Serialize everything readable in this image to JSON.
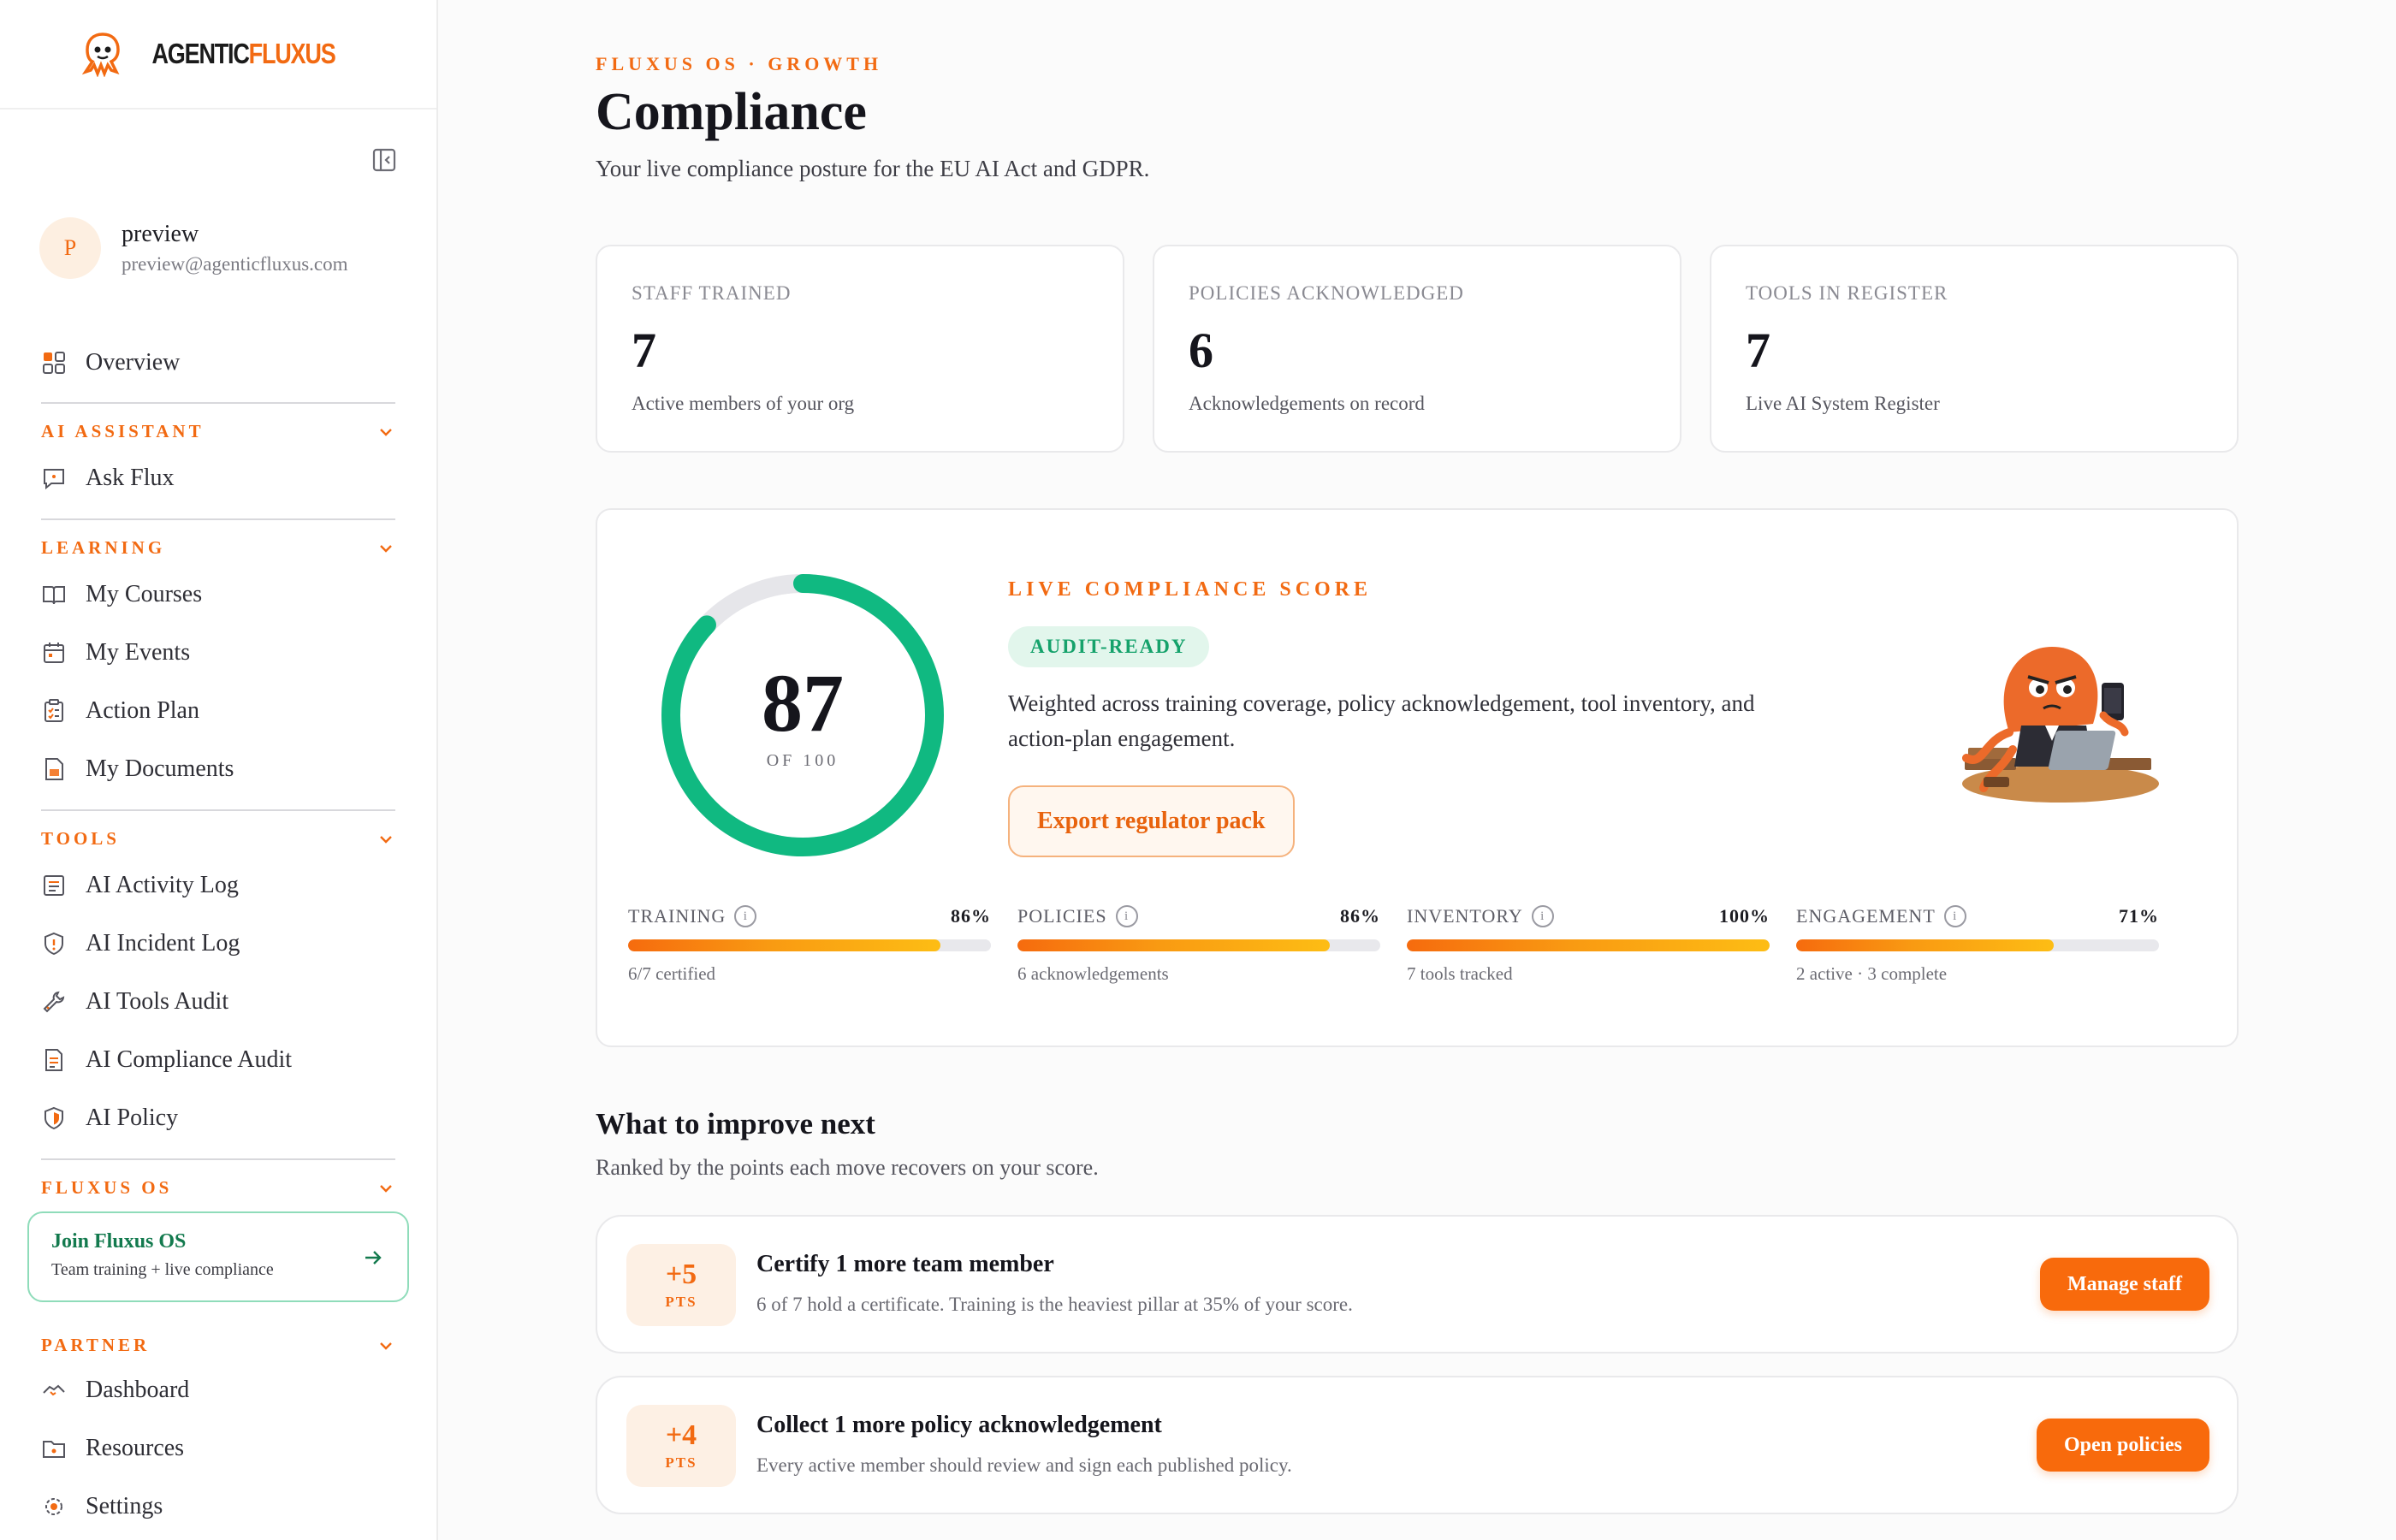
{
  "brand": {
    "part1": "AGENTIC",
    "part2": "FLUXUS"
  },
  "user": {
    "initial": "P",
    "name": "preview",
    "email": "preview@agenticfluxus.com"
  },
  "nav": {
    "overview": "Overview",
    "sections": {
      "ai_assistant": "AI ASSISTANT",
      "learning": "LEARNING",
      "tools": "TOOLS",
      "fluxus_os": "FLUXUS OS",
      "partner": "PARTNER"
    },
    "ask_flux": "Ask Flux",
    "learning_items": [
      "My Courses",
      "My Events",
      "Action Plan",
      "My Documents"
    ],
    "tools_items": [
      "AI Activity Log",
      "AI Incident Log",
      "AI Tools Audit",
      "AI Compliance Audit",
      "AI Policy"
    ],
    "join": {
      "title": "Join Fluxus OS",
      "subtitle": "Team training + live compliance"
    },
    "partner_items": [
      "Dashboard",
      "Resources",
      "Settings"
    ]
  },
  "header": {
    "eyebrow": "FLUXUS OS · GROWTH",
    "title": "Compliance",
    "subtitle": "Your live compliance posture for the EU AI Act and GDPR."
  },
  "stats": [
    {
      "label": "STAFF TRAINED",
      "value": "7",
      "note": "Active members of your org"
    },
    {
      "label": "POLICIES ACKNOWLEDGED",
      "value": "6",
      "note": "Acknowledgements on record"
    },
    {
      "label": "TOOLS IN REGISTER",
      "value": "7",
      "note": "Live AI System Register"
    }
  ],
  "score": {
    "value": 87,
    "value_text": "87",
    "max_text": "OF 100",
    "label": "LIVE COMPLIANCE SCORE",
    "badge": "AUDIT-READY",
    "description": "Weighted across training coverage, policy acknowledgement, tool inventory, and action-plan engagement.",
    "export_label": "Export regulator pack",
    "ring_color": "#10b981",
    "pillars": [
      {
        "label": "TRAINING",
        "pct": 86,
        "pct_text": "86%",
        "note": "6/7 certified"
      },
      {
        "label": "POLICIES",
        "pct": 86,
        "pct_text": "86%",
        "note": "6 acknowledgements"
      },
      {
        "label": "INVENTORY",
        "pct": 100,
        "pct_text": "100%",
        "note": "7 tools tracked"
      },
      {
        "label": "ENGAGEMENT",
        "pct": 71,
        "pct_text": "71%",
        "note": "2 active · 3 complete"
      }
    ]
  },
  "improve": {
    "title": "What to improve next",
    "subtitle": "Ranked by the points each move recovers on your score.",
    "items": [
      {
        "pts": "+5",
        "unit": "PTS",
        "title": "Certify 1 more team member",
        "desc": "6 of 7 hold a certificate. Training is the heaviest pillar at 35% of your score.",
        "action": "Manage staff"
      },
      {
        "pts": "+4",
        "unit": "PTS",
        "title": "Collect 1 more policy acknowledgement",
        "desc": "Every active member should review and sign each published policy.",
        "action": "Open policies"
      }
    ]
  },
  "colors": {
    "accent": "#f26a12",
    "success": "#10b981"
  }
}
